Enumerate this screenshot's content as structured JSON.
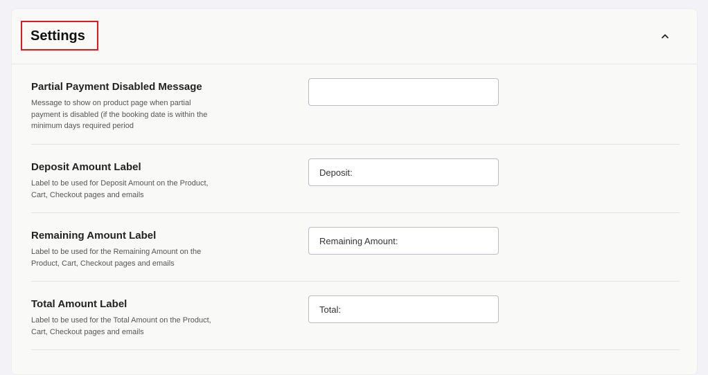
{
  "settings": {
    "title": "Settings",
    "collapse_icon": "chevron-up-icon",
    "rows": [
      {
        "label": "Partial Payment Disabled Message",
        "description": "Message to show on product page when partial payment is disabled (if the booking date is within the minimum days required period",
        "value": ""
      },
      {
        "label": "Deposit Amount Label",
        "description": "Label to be used for Deposit Amount on the Product, Cart, Checkout pages and emails",
        "value": "Deposit:"
      },
      {
        "label": "Remaining Amount Label",
        "description": "Label to be used for the Remaining Amount on the Product, Cart, Checkout pages and emails",
        "value": "Remaining Amount:"
      },
      {
        "label": "Total Amount Label",
        "description": "Label to be used for the Total Amount on the Product, Cart, Checkout pages and emails",
        "value": "Total:"
      }
    ]
  },
  "colors": {
    "highlight_border": "#e8151b",
    "panel_background": "#f9f9f8",
    "page_background": "#f3f3f7"
  }
}
